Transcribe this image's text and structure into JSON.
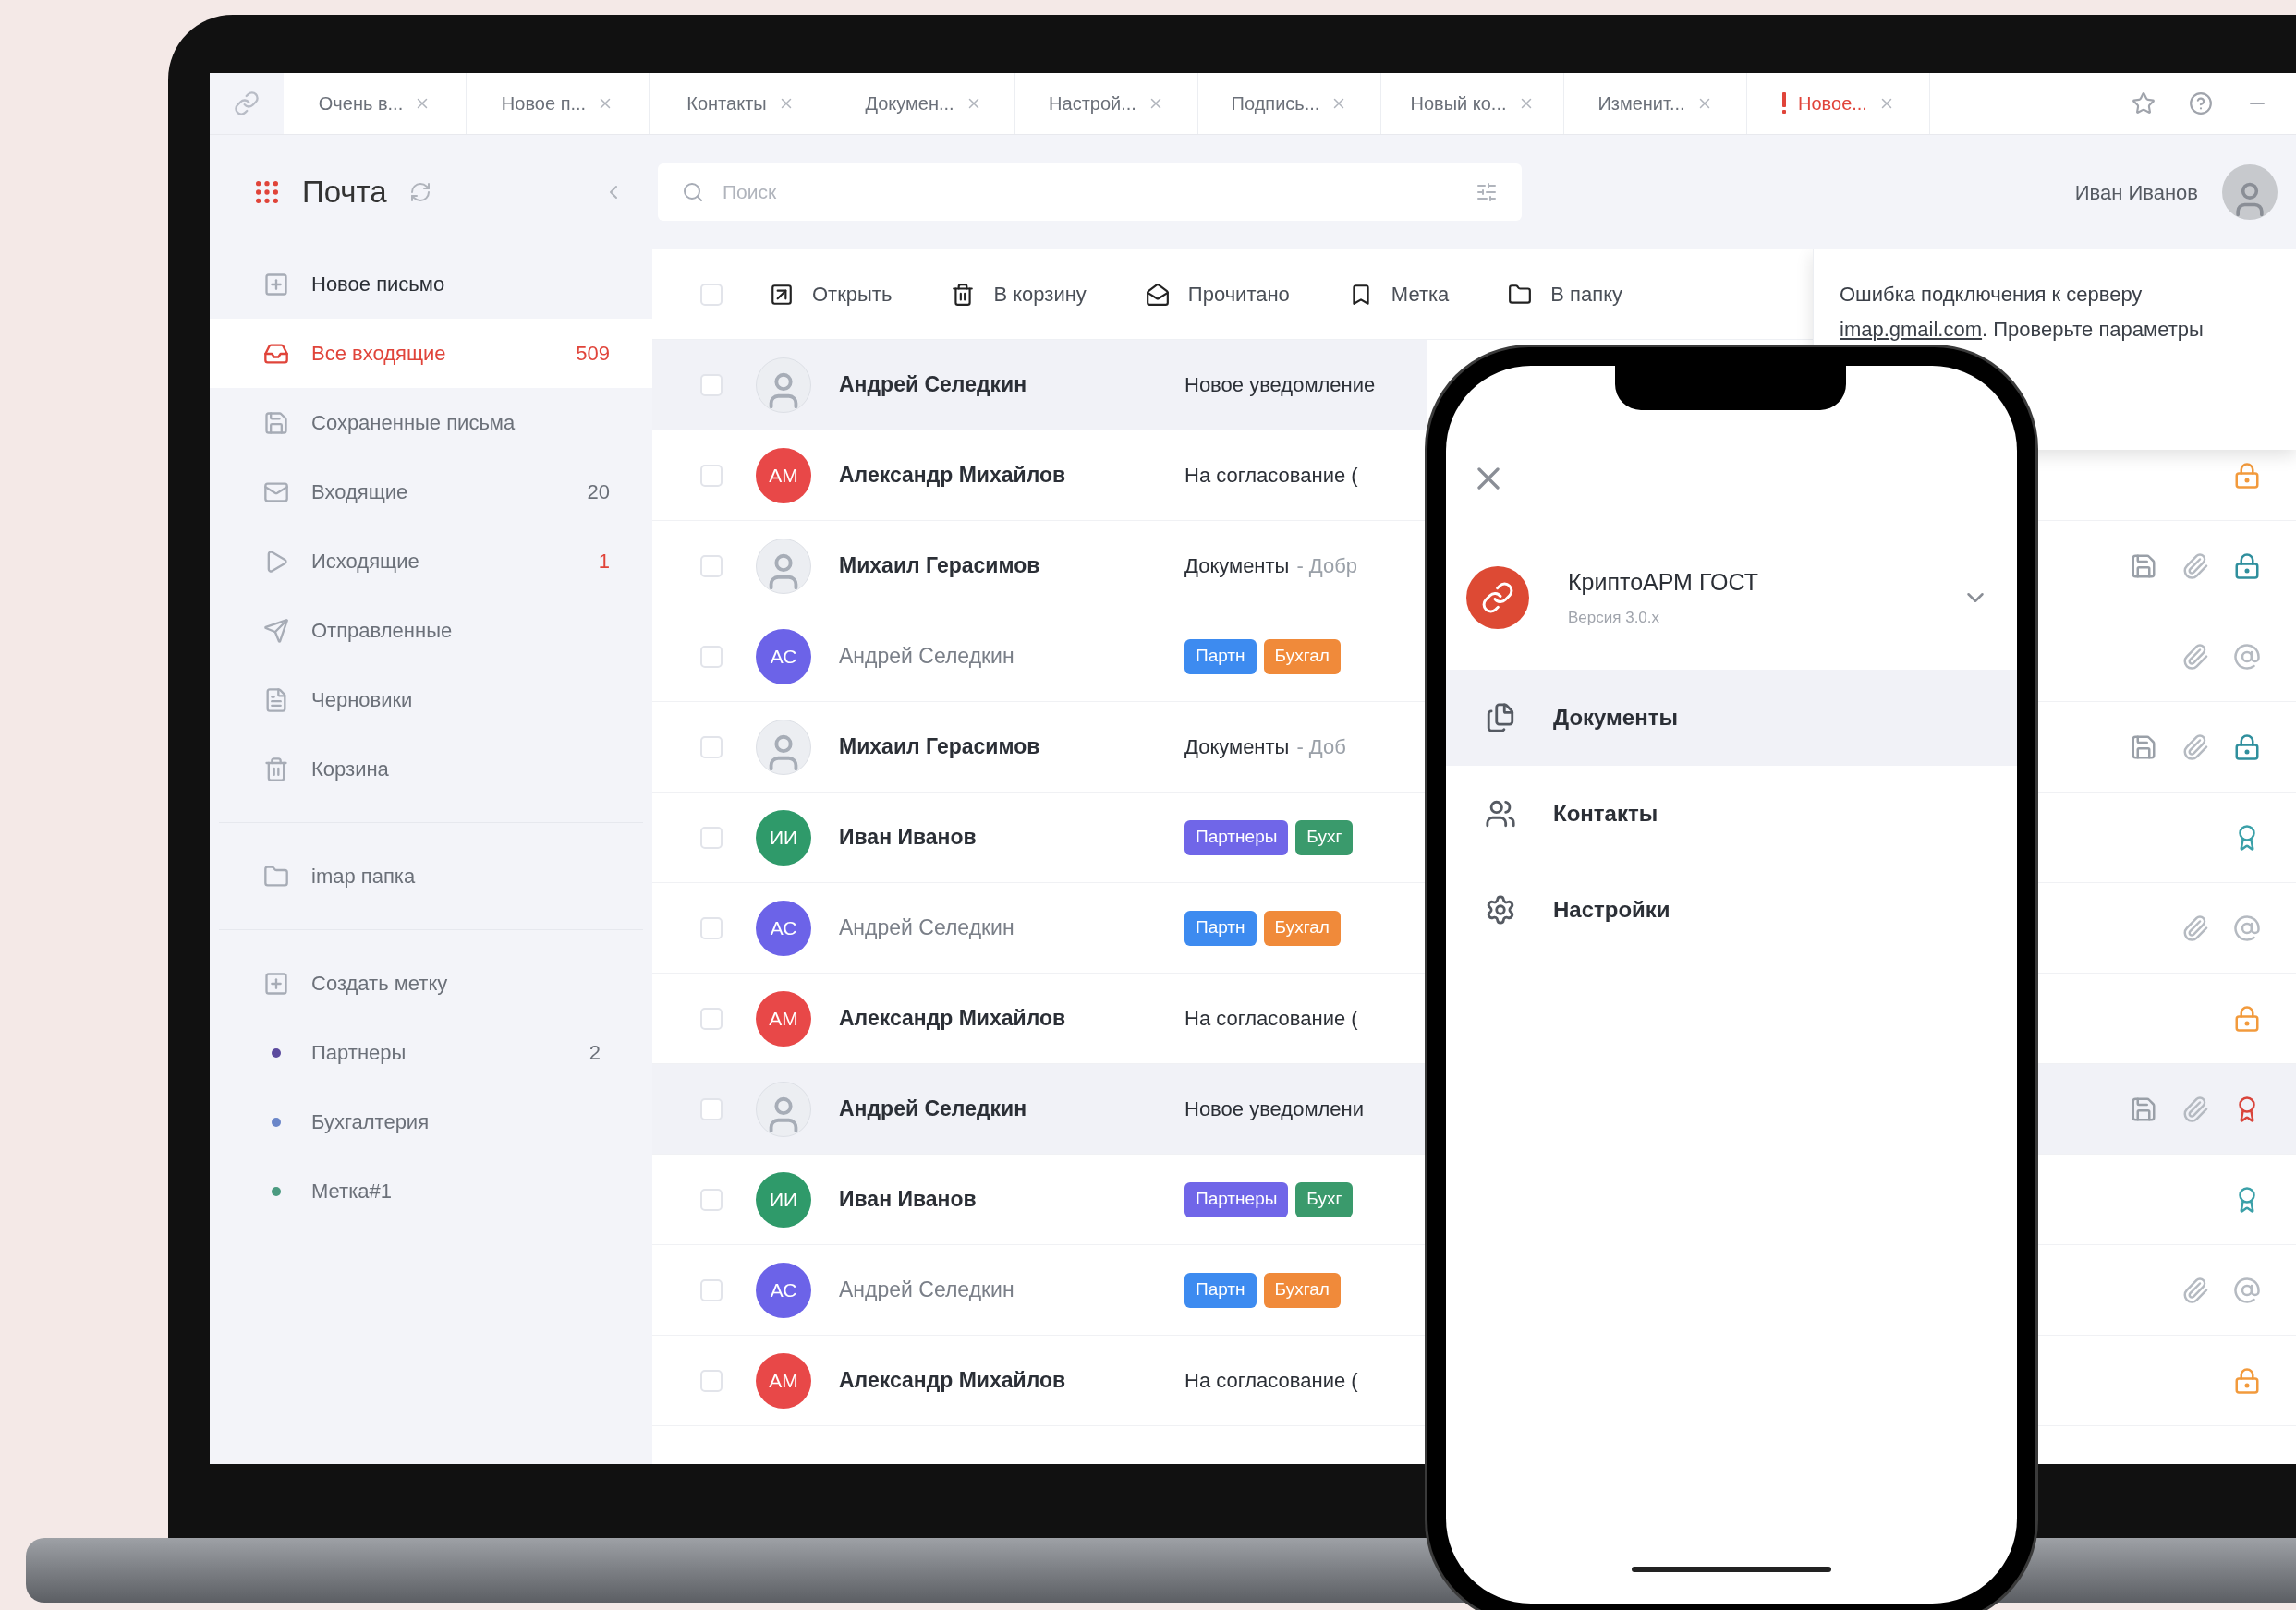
{
  "tabs": [
    {
      "label": "Очень в...",
      "alert": false
    },
    {
      "label": "Новое п...",
      "alert": false
    },
    {
      "label": "Контакты",
      "alert": false
    },
    {
      "label": "Докумен...",
      "alert": false
    },
    {
      "label": "Настрой...",
      "alert": false
    },
    {
      "label": "Подпись...",
      "alert": false
    },
    {
      "label": "Новый ко...",
      "alert": false
    },
    {
      "label": "Изменит...",
      "alert": false
    },
    {
      "label": "Новое...",
      "alert": true
    }
  ],
  "app": {
    "title": "Почта"
  },
  "search": {
    "placeholder": "Поиск"
  },
  "user": {
    "name": "Иван Иванов"
  },
  "sidebar": {
    "groups": [
      [
        {
          "kind": "action",
          "label": "Новое письмо",
          "selected": false
        },
        {
          "kind": "folder",
          "label": "Все входящие",
          "count": "509",
          "selected": true,
          "alert": true
        },
        {
          "kind": "folder",
          "label": "Сохраненные письма",
          "selected": false
        },
        {
          "kind": "folder",
          "label": "Входящие",
          "count": "20",
          "selected": false,
          "alert": false
        },
        {
          "kind": "folder",
          "label": "Исходящие",
          "count": "1",
          "selected": false,
          "alert": true
        },
        {
          "kind": "folder",
          "label": "Отправленные",
          "selected": false
        },
        {
          "kind": "folder",
          "label": "Черновики",
          "selected": false
        },
        {
          "kind": "folder",
          "label": "Корзина",
          "selected": false
        }
      ],
      [
        {
          "kind": "folder",
          "label": "imap папка",
          "selected": false
        }
      ],
      [
        {
          "kind": "action",
          "label": "Создать метку",
          "selected": false
        },
        {
          "kind": "label",
          "label": "Партнеры",
          "count": "2",
          "color": "#5b4a9e",
          "selected": false,
          "alert": false
        },
        {
          "kind": "label",
          "label": "Бухгалтерия",
          "color": "#6a86c9",
          "selected": false
        },
        {
          "kind": "label",
          "label": "Метка#1",
          "color": "#4a9a80",
          "selected": false
        }
      ]
    ]
  },
  "toolbar": {
    "checked": false,
    "buttons": [
      {
        "label": "Открыть"
      },
      {
        "label": "В корзину"
      },
      {
        "label": "Прочитано"
      },
      {
        "label": "Метка"
      },
      {
        "label": "В папку"
      }
    ]
  },
  "notification": {
    "text_before": "Ошибка подключения к серверу",
    "link": "imap.gmail.com",
    "text_after": ". Проверьте параметры"
  },
  "rows": [
    {
      "checked": false,
      "highlighted": true,
      "unread": true,
      "avatar": {
        "kind": "photo"
      },
      "sender": "Андрей Селедкин",
      "kind": "subject",
      "subject": "Новое уведомление",
      "icons": []
    },
    {
      "checked": false,
      "highlighted": false,
      "unread": true,
      "avatar": {
        "kind": "initials",
        "initials": "АМ",
        "color": "#e84848"
      },
      "sender": "Александр Михайлов",
      "kind": "subject",
      "subject": "На согласование (",
      "icons": [
        {
          "kind": "lock",
          "color": "#f29a3c"
        }
      ]
    },
    {
      "checked": false,
      "highlighted": false,
      "unread": true,
      "avatar": {
        "kind": "photo"
      },
      "sender": "Михаил Герасимов",
      "kind": "subject",
      "subject": "Документы",
      "preview": "- Добр",
      "icons": [
        {
          "kind": "save",
          "color": "#9aa0a8"
        },
        {
          "kind": "clip",
          "color": "#b5bac1"
        },
        {
          "kind": "lock",
          "color": "#2f8f9d"
        }
      ]
    },
    {
      "checked": false,
      "highlighted": false,
      "unread": false,
      "avatar": {
        "kind": "initials",
        "initials": "АС",
        "color": "#6c63e8"
      },
      "sender": "Андрей Селедкин",
      "kind": "tags",
      "tags": [
        {
          "label": "Партн",
          "color": "#3d8bf0"
        },
        {
          "label": "Бухгал",
          "color": "#f08a3a"
        }
      ],
      "icons": [
        {
          "kind": "clip",
          "color": "#b5bac1"
        },
        {
          "kind": "at",
          "color": "#b5bac1"
        }
      ]
    },
    {
      "checked": false,
      "highlighted": false,
      "unread": true,
      "avatar": {
        "kind": "photo"
      },
      "sender": "Михаил Герасимов",
      "kind": "subject",
      "subject": "Документы",
      "preview": "- Доб",
      "icons": [
        {
          "kind": "save",
          "color": "#9aa0a8"
        },
        {
          "kind": "clip",
          "color": "#b5bac1"
        },
        {
          "kind": "lock",
          "color": "#2f8f9d"
        }
      ]
    },
    {
      "checked": false,
      "highlighted": false,
      "unread": true,
      "avatar": {
        "kind": "initials",
        "initials": "ИИ",
        "color": "#2f9a6a"
      },
      "sender": "Иван Иванов",
      "kind": "tags",
      "tags": [
        {
          "label": "Партнеры",
          "color": "#7066e8"
        },
        {
          "label": "Бухг",
          "color": "#3a9a6c"
        }
      ],
      "icons": [
        {
          "kind": "award",
          "color": "#3aa0a8"
        }
      ]
    },
    {
      "checked": false,
      "highlighted": false,
      "unread": false,
      "avatar": {
        "kind": "initials",
        "initials": "АС",
        "color": "#6c63e8"
      },
      "sender": "Андрей Селедкин",
      "kind": "tags",
      "tags": [
        {
          "label": "Партн",
          "color": "#3d8bf0"
        },
        {
          "label": "Бухгал",
          "color": "#f08a3a"
        }
      ],
      "icons": [
        {
          "kind": "clip",
          "color": "#b5bac1"
        },
        {
          "kind": "at",
          "color": "#b5bac1"
        }
      ]
    },
    {
      "checked": false,
      "highlighted": false,
      "unread": true,
      "avatar": {
        "kind": "initials",
        "initials": "АМ",
        "color": "#e84848"
      },
      "sender": "Александр Михайлов",
      "kind": "subject",
      "subject": "На согласование (",
      "icons": [
        {
          "kind": "lock",
          "color": "#f29a3c"
        }
      ]
    },
    {
      "checked": false,
      "highlighted": true,
      "unread": true,
      "avatar": {
        "kind": "photo"
      },
      "sender": "Андрей Селедкин",
      "kind": "subject",
      "subject": "Новое уведомлени",
      "icons": [
        {
          "kind": "save",
          "color": "#9aa0a8"
        },
        {
          "kind": "clip",
          "color": "#b5bac1"
        },
        {
          "kind": "award",
          "color": "#d9443a"
        }
      ]
    },
    {
      "checked": false,
      "highlighted": false,
      "unread": true,
      "avatar": {
        "kind": "initials",
        "initials": "ИИ",
        "color": "#2f9a6a"
      },
      "sender": "Иван Иванов",
      "kind": "tags",
      "tags": [
        {
          "label": "Партнеры",
          "color": "#7066e8"
        },
        {
          "label": "Бухг",
          "color": "#3a9a6c"
        }
      ],
      "icons": [
        {
          "kind": "award",
          "color": "#3aa0a8"
        }
      ]
    },
    {
      "checked": false,
      "highlighted": false,
      "unread": false,
      "avatar": {
        "kind": "initials",
        "initials": "АС",
        "color": "#6c63e8"
      },
      "sender": "Андрей Селедкин",
      "kind": "tags",
      "tags": [
        {
          "label": "Партн",
          "color": "#3d8bf0"
        },
        {
          "label": "Бухгал",
          "color": "#f08a3a"
        }
      ],
      "icons": [
        {
          "kind": "clip",
          "color": "#b5bac1"
        },
        {
          "kind": "at",
          "color": "#b5bac1"
        }
      ]
    },
    {
      "checked": false,
      "highlighted": false,
      "unread": true,
      "avatar": {
        "kind": "initials",
        "initials": "АМ",
        "color": "#e84848"
      },
      "sender": "Александр Михайлов",
      "kind": "subject",
      "subject": "На согласование (",
      "icons": [
        {
          "kind": "lock",
          "color": "#f29a3c"
        }
      ]
    }
  ],
  "phone": {
    "app_name": "КриптоАРМ ГОСТ",
    "version": "Версия 3.0.x",
    "menu": [
      {
        "label": "Документы",
        "selected": true
      },
      {
        "label": "Контакты",
        "selected": false
      },
      {
        "label": "Настройки",
        "selected": false
      }
    ]
  }
}
